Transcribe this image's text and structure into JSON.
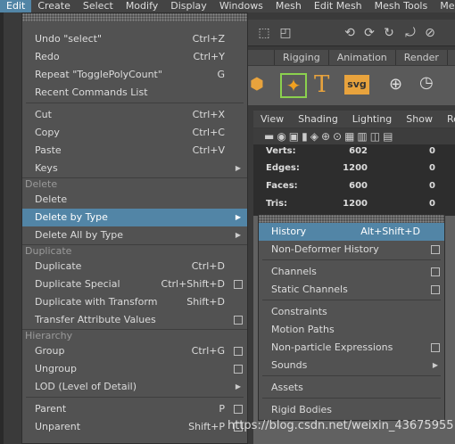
{
  "menubar": [
    "Edit",
    "Create",
    "Select",
    "Modify",
    "Display",
    "Windows",
    "Mesh",
    "Edit Mesh",
    "Mesh Tools",
    "Mesh"
  ],
  "shelf_tabs": [
    "",
    "Rigging",
    "Animation",
    "Render"
  ],
  "shelf_icon_text": "svg",
  "panel_menu": [
    "View",
    "Shading",
    "Lighting",
    "Show",
    "Ren"
  ],
  "hud": [
    {
      "label": "Verts:",
      "v1": "602",
      "v2": "0"
    },
    {
      "label": "Edges:",
      "v1": "1200",
      "v2": "0"
    },
    {
      "label": "Faces:",
      "v1": "600",
      "v2": "0"
    },
    {
      "label": "Tris:",
      "v1": "1200",
      "v2": "0"
    }
  ],
  "edit_menu": {
    "undo": {
      "label": "Undo \"select\"",
      "shortcut": "Ctrl+Z"
    },
    "redo": {
      "label": "Redo",
      "shortcut": "Ctrl+Y"
    },
    "repeat": {
      "label": "Repeat \"TogglePolyCount\"",
      "shortcut": "G"
    },
    "recent": {
      "label": "Recent Commands List"
    },
    "cut": {
      "label": "Cut",
      "shortcut": "Ctrl+X"
    },
    "copy": {
      "label": "Copy",
      "shortcut": "Ctrl+C"
    },
    "paste": {
      "label": "Paste",
      "shortcut": "Ctrl+V"
    },
    "keys": {
      "label": "Keys"
    },
    "sec_delete": "Delete",
    "delete": {
      "label": "Delete"
    },
    "delete_by_type": {
      "label": "Delete by Type"
    },
    "delete_all_by_type": {
      "label": "Delete All by Type"
    },
    "sec_duplicate": "Duplicate",
    "duplicate": {
      "label": "Duplicate",
      "shortcut": "Ctrl+D"
    },
    "duplicate_special": {
      "label": "Duplicate Special",
      "shortcut": "Ctrl+Shift+D"
    },
    "duplicate_transform": {
      "label": "Duplicate with Transform",
      "shortcut": "Shift+D"
    },
    "transfer_attr": {
      "label": "Transfer Attribute Values"
    },
    "sec_hierarchy": "Hierarchy",
    "group": {
      "label": "Group",
      "shortcut": "Ctrl+G"
    },
    "ungroup": {
      "label": "Ungroup"
    },
    "lod": {
      "label": "LOD (Level of Detail)"
    },
    "parent": {
      "label": "Parent",
      "shortcut": "P"
    },
    "unparent": {
      "label": "Unparent",
      "shortcut": "Shift+P"
    }
  },
  "submenu": {
    "history": {
      "label": "History",
      "shortcut": "Alt+Shift+D"
    },
    "non_deformer": {
      "label": "Non-Deformer History"
    },
    "channels": {
      "label": "Channels"
    },
    "static_channels": {
      "label": "Static Channels"
    },
    "constraints": {
      "label": "Constraints"
    },
    "motion_paths": {
      "label": "Motion Paths"
    },
    "non_particle": {
      "label": "Non-particle Expressions"
    },
    "sounds": {
      "label": "Sounds"
    },
    "assets": {
      "label": "Assets"
    },
    "rigid_bodies": {
      "label": "Rigid Bodies"
    }
  },
  "watermark": "https://blog.csdn.net/weixin_43675955",
  "colors": {
    "highlight": "#5285a6",
    "menu_bg": "#525252"
  }
}
